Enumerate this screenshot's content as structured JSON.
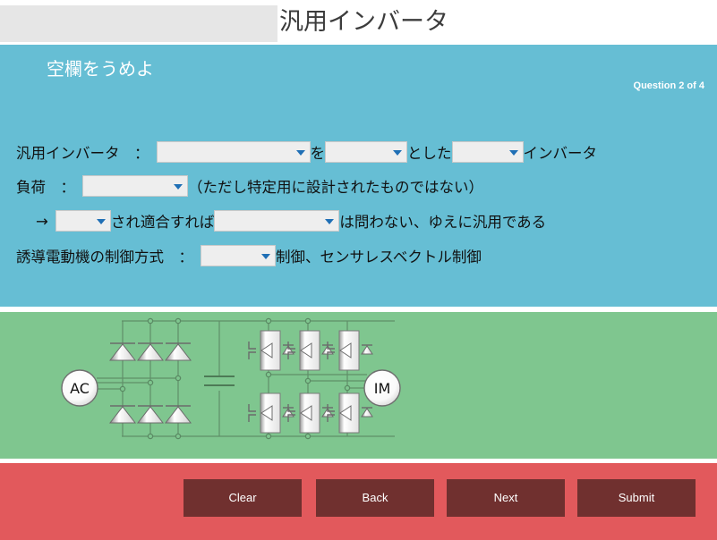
{
  "title_bar": {
    "page_title": "汎用インバータ"
  },
  "question_panel": {
    "heading": "空欄をうめよ",
    "counter": "Question 2 of 4",
    "bg_color": "#66bed4",
    "rows": [
      {
        "label": "汎用インバータ　：",
        "segments": [
          {
            "type": "select",
            "value": "",
            "width": "w-170"
          },
          {
            "type": "text",
            "value": "を"
          },
          {
            "type": "select",
            "value": "",
            "width": "w-92"
          },
          {
            "type": "text",
            "value": "とした"
          },
          {
            "type": "select",
            "value": "",
            "width": "w-80"
          },
          {
            "type": "text",
            "value": "インバータ"
          }
        ]
      },
      {
        "label": "負荷　：",
        "segments": [
          {
            "type": "select",
            "value": "",
            "width": "w-118"
          },
          {
            "type": "text",
            "value": "（ただし特定用に設計されたものではない）"
          }
        ]
      },
      {
        "label": "→",
        "segments": [
          {
            "type": "select",
            "value": "",
            "width": "w-62"
          },
          {
            "type": "text",
            "value": "され適合すれば"
          },
          {
            "type": "select",
            "value": "",
            "width": "w-140"
          },
          {
            "type": "text",
            "value": "は問わない、ゆえに汎用である"
          }
        ]
      },
      {
        "label": "誘導電動機の制御方式　：",
        "segments": [
          {
            "type": "select",
            "value": "",
            "width": "w-84"
          },
          {
            "type": "text",
            "value": "制御、センサレスベクトル制御"
          }
        ]
      }
    ]
  },
  "circuit_panel": {
    "bg_color": "#7fc68f",
    "source_label": "AC",
    "motor_label": "IM",
    "description": "three-phase diode rectifier bridge, DC-link capacitor, three-phase IGBT inverter bridge"
  },
  "footer": {
    "bg_color": "#e2595c",
    "button_color": "#70302f",
    "buttons": [
      {
        "id": "clear",
        "label": "Clear"
      },
      {
        "id": "back",
        "label": "Back"
      },
      {
        "id": "next",
        "label": "Next"
      },
      {
        "id": "submit",
        "label": "Submit"
      }
    ]
  }
}
